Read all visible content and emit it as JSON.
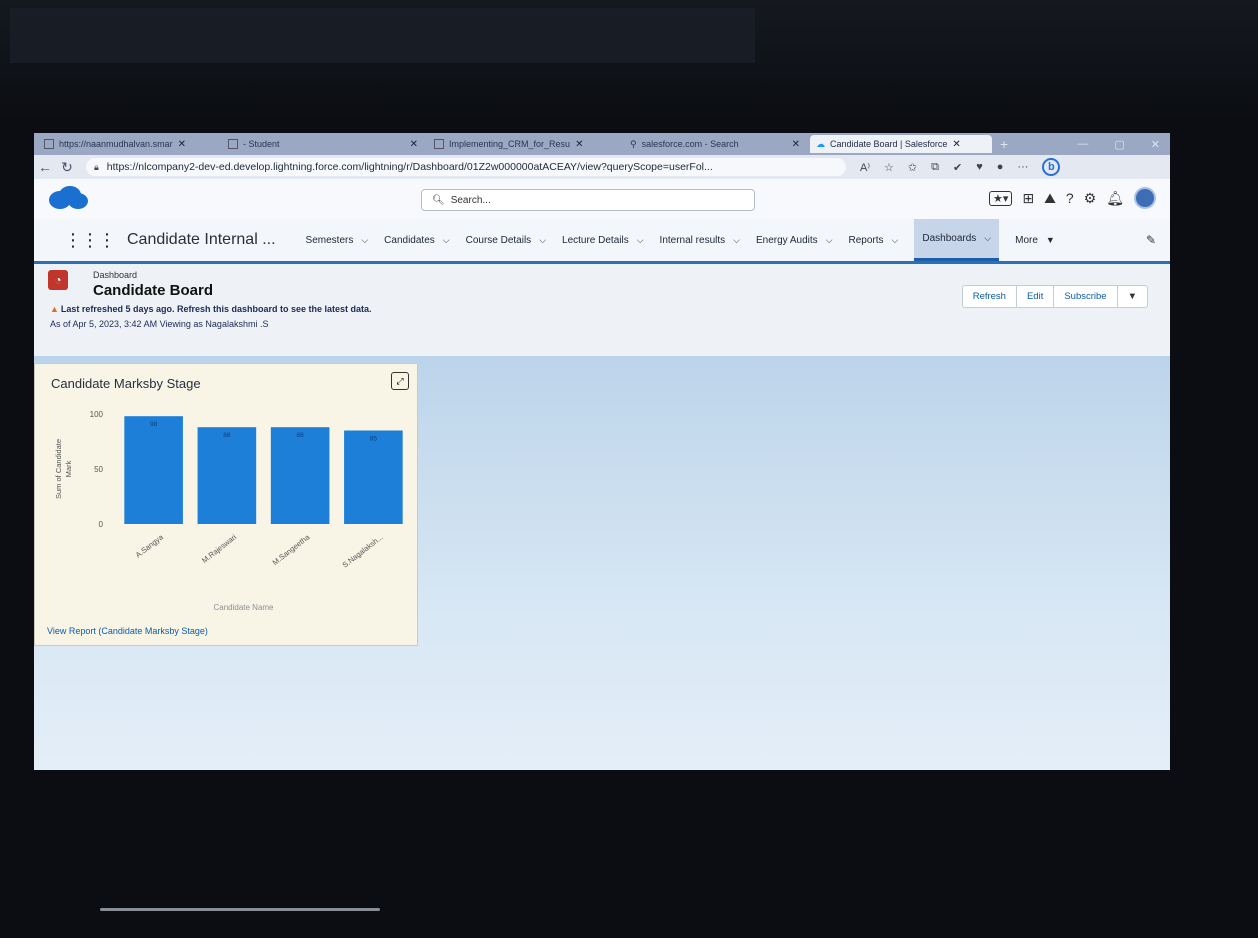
{
  "browser": {
    "tabs": [
      {
        "label": "https://naanmudhalvan.smar",
        "active": false
      },
      {
        "label": "- Student",
        "active": false
      },
      {
        "label": "Implementing_CRM_for_Resu",
        "active": false
      },
      {
        "label": "salesforce.com - Search",
        "active": false
      },
      {
        "label": "Candidate Board | Salesforce",
        "active": true
      }
    ],
    "url": "https://nlcompany2-dev-ed.develop.lightning.force.com/lightning/r/Dashboard/01Z2w000000atACEAY/view?queryScope=userFol..."
  },
  "header": {
    "search_placeholder": "Search..."
  },
  "nav": {
    "app_name": "Candidate Internal ...",
    "items": [
      {
        "label": "Semesters"
      },
      {
        "label": "Candidates"
      },
      {
        "label": "Course Details"
      },
      {
        "label": "Lecture Details"
      },
      {
        "label": "Internal results"
      },
      {
        "label": "Energy Audits"
      },
      {
        "label": "Reports"
      },
      {
        "label": "Dashboards"
      },
      {
        "label": "More"
      }
    ]
  },
  "dashboard": {
    "kind_label": "Dashboard",
    "title": "Candidate Board",
    "warning": "Last refreshed 5 days ago. Refresh this dashboard to see the latest data.",
    "as_of": "As of Apr 5, 2023, 3:42 AM Viewing as Nagalakshmi .S",
    "buttons": {
      "refresh": "Refresh",
      "edit": "Edit",
      "subscribe": "Subscribe"
    }
  },
  "widget": {
    "title": "Candidate Marksby Stage",
    "view_report": "View Report (Candidate Marksby Stage)"
  },
  "chart_data": {
    "type": "bar",
    "categories": [
      "A.Sangya",
      "M.Rajeswari",
      "M.Sangeetha",
      "S.Nagalaksh..."
    ],
    "values": [
      98,
      88,
      88,
      85
    ],
    "data_labels": [
      "98",
      "88",
      "88",
      "85"
    ],
    "y_ticks": [
      "100",
      "50",
      "0"
    ],
    "ylim": [
      0,
      100
    ],
    "ylabel": "Sum of Candidate Mark",
    "xlabel": "Candidate Name",
    "bar_color": "#1e7fd8",
    "grid": false
  }
}
